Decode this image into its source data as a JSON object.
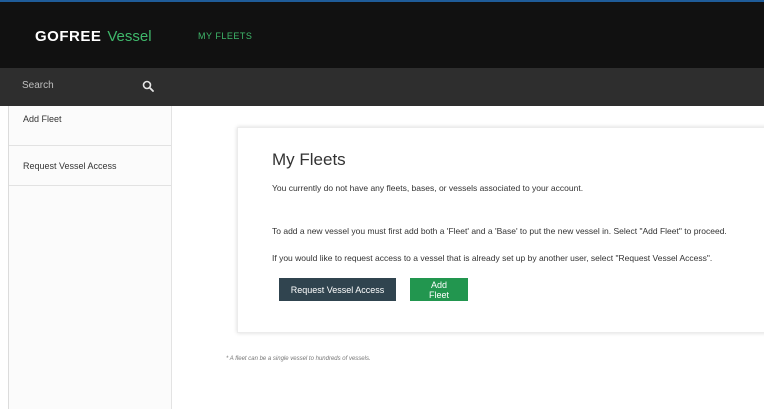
{
  "header": {
    "logo_text": "GOFREE",
    "logo_product": "Vessel",
    "nav_item": "MY FLEETS"
  },
  "search": {
    "placeholder": "Search"
  },
  "sidebar": {
    "items": [
      {
        "label": "Add Fleet"
      },
      {
        "label": "Request Vessel Access"
      }
    ]
  },
  "main": {
    "title": "My Fleets",
    "paragraph1": "You currently do not have any fleets, bases, or vessels associated to your account.",
    "paragraph2": "To add a new vessel you must first add both a 'Fleet' and a 'Base' to put the new vessel in. Select \"Add Fleet\" to proceed.",
    "paragraph3": "If you would like to request access to a vessel that is already set up by another user, select \"Request Vessel Access\".",
    "request_button": "Request Vessel Access",
    "add_button": "Add Fleet"
  },
  "footnote": "* A fleet can be a single vessel to hundreds of vessels.",
  "colors": {
    "brand_green": "#3fb86b",
    "top_bar": "#111111",
    "search_bar": "#2e2e2e",
    "request_button": "#30444f",
    "add_button": "#22964f"
  }
}
